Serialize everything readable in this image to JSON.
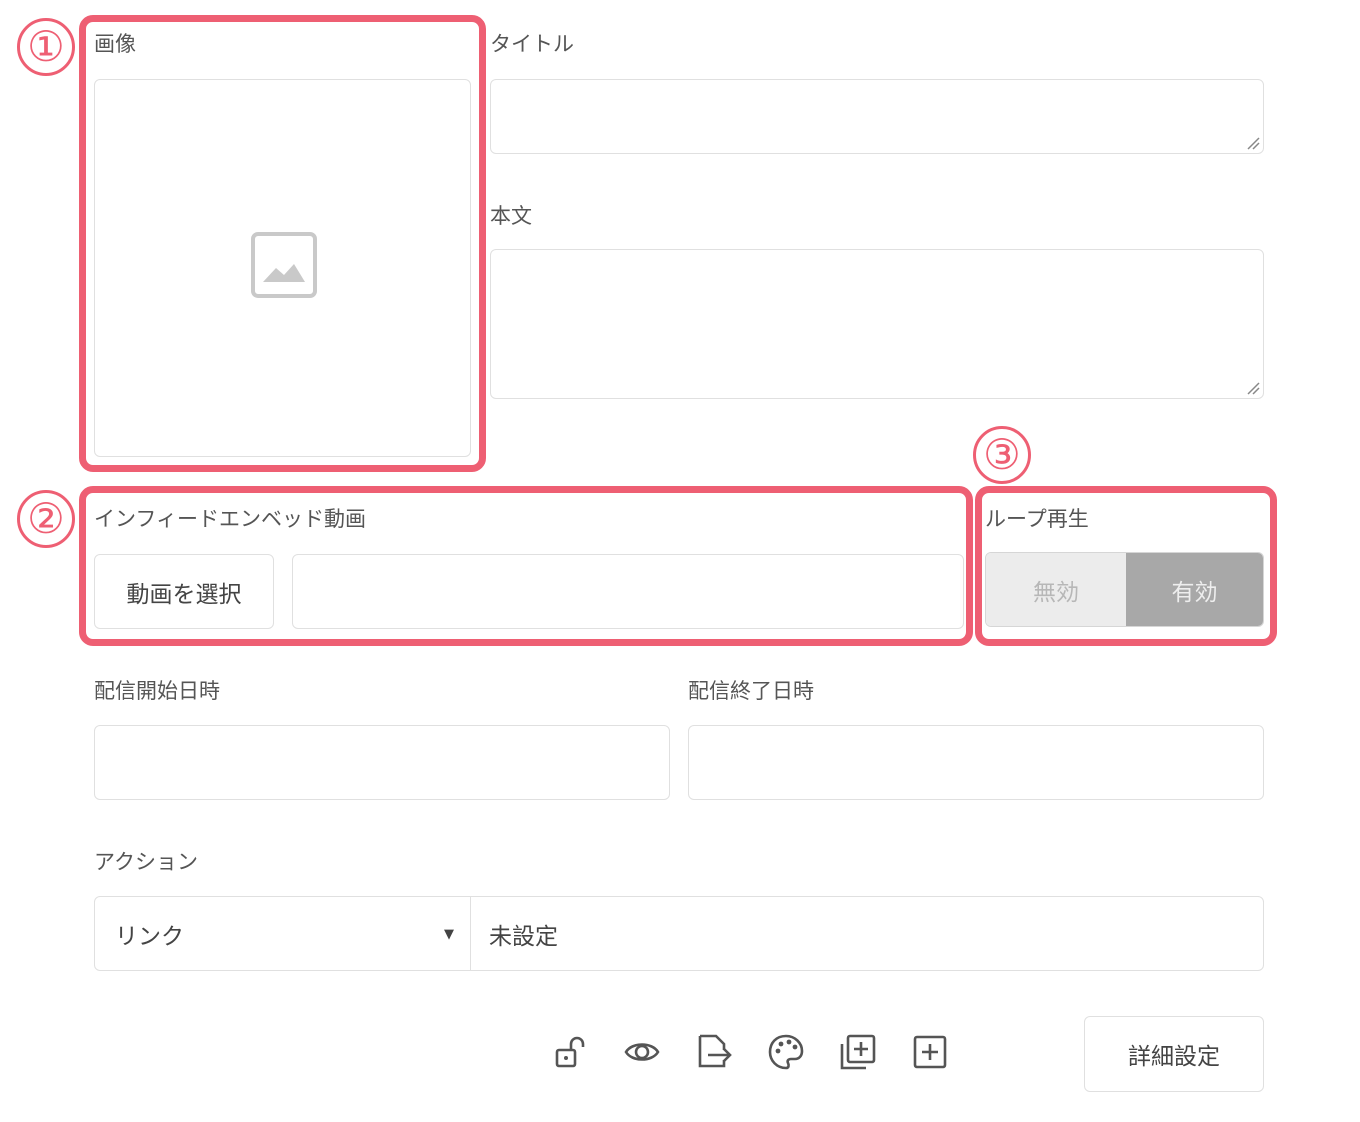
{
  "image_section": {
    "label": "画像",
    "placeholder_icon": "image-icon"
  },
  "title_field": {
    "label": "タイトル",
    "value": ""
  },
  "body_field": {
    "label": "本文",
    "value": ""
  },
  "infeed": {
    "label": "インフィードエンベッド動画",
    "select_button": "動画を選択",
    "value": ""
  },
  "loop": {
    "label": "ループ再生",
    "off_label": "無効",
    "on_label": "有効",
    "selected": "有効"
  },
  "start_date": {
    "label": "配信開始日時",
    "value": ""
  },
  "end_date": {
    "label": "配信終了日時",
    "value": ""
  },
  "action": {
    "label": "アクション",
    "selected": "リンク",
    "value": "未設定"
  },
  "toolbar": {
    "icons": [
      "unlock-icon",
      "eye-icon",
      "file-export-icon",
      "palette-icon",
      "duplicate-icon",
      "add-icon"
    ],
    "details_button": "詳細設定"
  },
  "annotations": {
    "one": "①",
    "two": "②",
    "three": "③",
    "color": "#ee5f73"
  }
}
